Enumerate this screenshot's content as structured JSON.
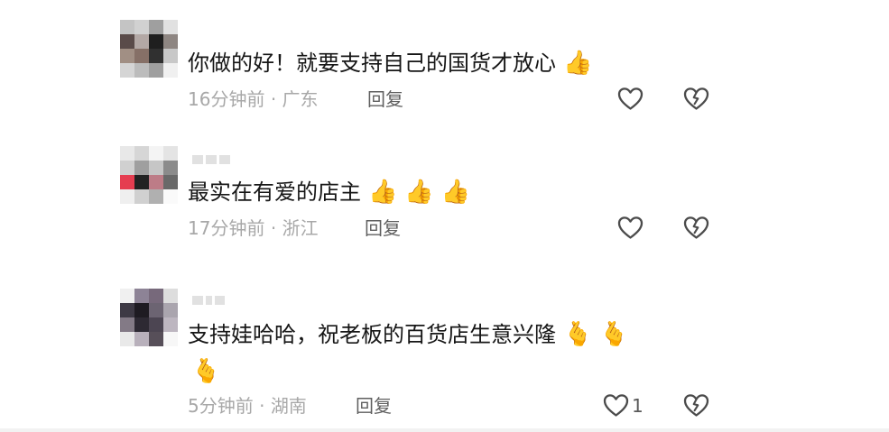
{
  "comments": [
    {
      "text": "你做的好！就要支持自己的国货才放心",
      "emoji": [
        "👍"
      ],
      "time": "16分钟前",
      "location": "广东",
      "reply": "回复",
      "like_count": ""
    },
    {
      "text": "最实在有爱的店主",
      "emoji": [
        "👍",
        "👍",
        "👍"
      ],
      "time": "17分钟前",
      "location": "浙江",
      "reply": "回复",
      "like_count": ""
    },
    {
      "text": "支持娃哈哈，祝老板的百货店生意兴隆",
      "emoji": [
        "🫰",
        "🫰",
        "🫰"
      ],
      "time": "5分钟前",
      "location": "湖南",
      "reply": "回复",
      "like_count": "1"
    }
  ],
  "icons": {
    "like": "heart-outline-icon",
    "dislike": "broken-heart-icon",
    "reaction": "thumbs-up-icon",
    "reaction_alt": "finger-heart-icon"
  },
  "colors": {
    "text": "#161616",
    "meta": "#a8a8a8",
    "reply": "#5f5f5f",
    "icon": "#4b4b4b"
  }
}
